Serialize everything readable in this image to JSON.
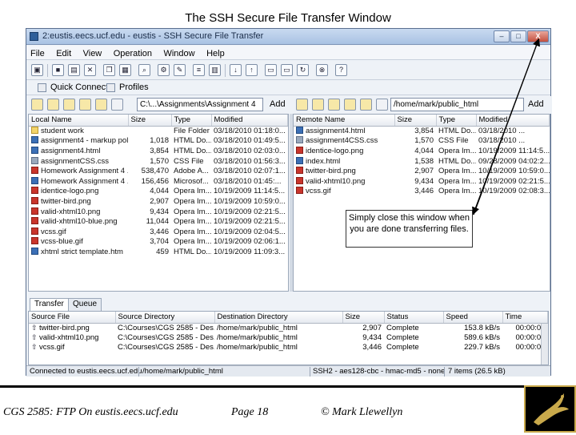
{
  "slide": {
    "title": "The SSH Secure File Transfer Window",
    "footer_course": "CGS 2585:  FTP On eustis.eecs.ucf.edu",
    "footer_page": "Page 18",
    "footer_author": "© Mark Llewellyn",
    "callout": "Simply close this window when you are done transferring files."
  },
  "window": {
    "title": "2:eustis.eecs.ucf.edu - eustis - SSH Secure File Transfer",
    "buttons": {
      "minimize": "–",
      "maximize": "□",
      "close": "X"
    }
  },
  "menu": [
    "File",
    "Edit",
    "View",
    "Operation",
    "Window",
    "Help"
  ],
  "connbar": {
    "quick_connect": "Quick Connect",
    "profiles": "Profiles"
  },
  "local": {
    "path": "C:\\...\\Assignments\\Assignment 4",
    "add_label": "Add",
    "columns": [
      "Local Name",
      "Size",
      "Type",
      "Modified"
    ],
    "files": [
      {
        "name": "student work",
        "size": "",
        "type": "File Folder",
        "modified": "03/18/2010 01:18:0...",
        "icon": "folder"
      },
      {
        "name": "assignment4 - markup pol...",
        "size": "1,018",
        "type": "HTML Do...",
        "modified": "03/18/2010 01:49:5...",
        "icon": "html"
      },
      {
        "name": "assignment4.html",
        "size": "3,854",
        "type": "HTML Do...",
        "modified": "03/18/2010 02:03:0...",
        "icon": "html"
      },
      {
        "name": "assignmentCSS.css",
        "size": "1,570",
        "type": "CSS File",
        "modified": "03/18/2010 01:56:3...",
        "icon": "css"
      },
      {
        "name": "Homework Assignment 4 ...",
        "size": "538,470",
        "type": "Adobe A...",
        "modified": "03/18/2010 02:07:1...",
        "icon": "red"
      },
      {
        "name": "Homework Assignment 4 ...",
        "size": "156,456",
        "type": "Microsof...",
        "modified": "03/18/2010 01:45:...",
        "icon": "html"
      },
      {
        "name": "identice-logo.png",
        "size": "4,044",
        "type": "Opera Im...",
        "modified": "10/19/2009 11:14:5...",
        "icon": "red"
      },
      {
        "name": "twitter-bird.png",
        "size": "2,907",
        "type": "Opera Im...",
        "modified": "10/19/2009 10:59:0...",
        "icon": "red"
      },
      {
        "name": "valid-xhtml10.png",
        "size": "9,434",
        "type": "Opera Im...",
        "modified": "10/19/2009 02:21:5...",
        "icon": "red"
      },
      {
        "name": "valid-xhtml10-blue.png",
        "size": "11,044",
        "type": "Opera Im...",
        "modified": "10/19/2009 02:21:5...",
        "icon": "red"
      },
      {
        "name": "vcss.gif",
        "size": "3,446",
        "type": "Opera Im...",
        "modified": "10/19/2009 02:04:5...",
        "icon": "red"
      },
      {
        "name": "vcss-blue.gif",
        "size": "3,704",
        "type": "Opera Im...",
        "modified": "10/19/2009 02:06:1...",
        "icon": "red"
      },
      {
        "name": "xhtml strict template.htm",
        "size": "459",
        "type": "HTML Do...",
        "modified": "10/19/2009 11:09:3...",
        "icon": "html"
      }
    ]
  },
  "remote": {
    "path": "/home/mark/public_html",
    "add_label": "Add",
    "columns": [
      "Remote Name",
      "Size",
      "Type",
      "Modified"
    ],
    "files": [
      {
        "name": "assignment4.html",
        "size": "3,854",
        "type": "HTML Do...",
        "modified": "03/18/2010 ...",
        "icon": "html"
      },
      {
        "name": "assignment4CSS.css",
        "size": "1,570",
        "type": "CSS File",
        "modified": "03/18/2010 ...",
        "icon": "css"
      },
      {
        "name": "identice-logo.png",
        "size": "4,044",
        "type": "Opera Im...",
        "modified": "10/19/2009 11:14:5...",
        "icon": "red"
      },
      {
        "name": "index.html",
        "size": "1,538",
        "type": "HTML Do...",
        "modified": "09/28/2009 04:02:2...",
        "icon": "html"
      },
      {
        "name": "twitter-bird.png",
        "size": "2,907",
        "type": "Opera Im...",
        "modified": "10/19/2009 10:59:0...",
        "icon": "red"
      },
      {
        "name": "valid-xhtml10.png",
        "size": "9,434",
        "type": "Opera Im...",
        "modified": "10/19/2009 02:21:5...",
        "icon": "red"
      },
      {
        "name": "vcss.gif",
        "size": "3,446",
        "type": "Opera Im...",
        "modified": "10/19/2009 02:08:3...",
        "icon": "red"
      }
    ]
  },
  "tabs": [
    "Transfer",
    "Queue"
  ],
  "transfers": {
    "columns": [
      "Source File",
      "Source Directory",
      "Destination Directory",
      "Size",
      "Status",
      "Speed",
      "Time"
    ],
    "rows": [
      {
        "file": "twitter-bird.png",
        "src": "C:\\Courses\\CGS 2585 - Des...",
        "dst": "/home/mark/public_html",
        "size": "2,907",
        "status": "Complete",
        "speed": "153.8 kB/s",
        "time": "00:00:00"
      },
      {
        "file": "valid-xhtml10.png",
        "src": "C:\\Courses\\CGS 2585 - Des...",
        "dst": "/home/mark/public_html",
        "size": "9,434",
        "status": "Complete",
        "speed": "589.6 kB/s",
        "time": "00:00:00"
      },
      {
        "file": "vcss.gif",
        "src": "C:\\Courses\\CGS 2585 - Des...",
        "dst": "/home/mark/public_html",
        "size": "3,446",
        "status": "Complete",
        "speed": "229.7 kB/s",
        "time": "00:00:00"
      }
    ]
  },
  "status": {
    "connection": "Connected to eustis.eecs.ucf.edu",
    "path": "/home/mark/public_html",
    "protocol": "SSH2 - aes128-cbc - hmac-md5 - none",
    "items": "7 items (26.5 kB)"
  }
}
